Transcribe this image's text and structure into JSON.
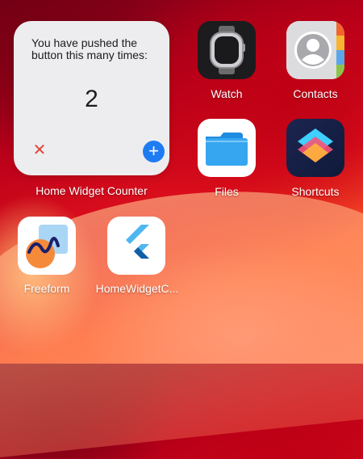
{
  "widget": {
    "message": "You have pushed the button this many times:",
    "count": "2",
    "label": "Home Widget Counter",
    "decrement_icon": "close-icon",
    "increment_icon": "plus-icon",
    "accent_color": "#1e7cf2"
  },
  "apps": [
    {
      "label": "Watch",
      "icon": "watch-icon"
    },
    {
      "label": "Contacts",
      "icon": "contacts-icon"
    },
    {
      "label": "Files",
      "icon": "folder-icon"
    },
    {
      "label": "Shortcuts",
      "icon": "shortcuts-icon"
    },
    {
      "label": "Freeform",
      "icon": "freeform-icon"
    },
    {
      "label": "HomeWidgetC...",
      "icon": "flutter-icon"
    }
  ]
}
